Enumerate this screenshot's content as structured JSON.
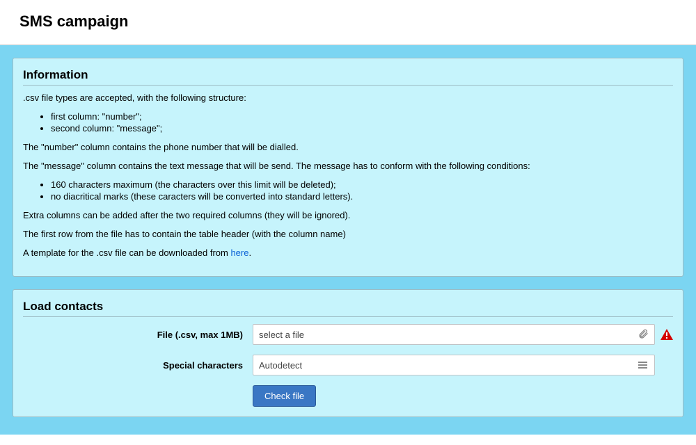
{
  "header": {
    "title": "SMS campaign"
  },
  "info": {
    "heading": "Information",
    "intro": ".csv file types are accepted, with the following structure:",
    "columns": [
      "first column: \"number\";",
      "second column: \"message\";"
    ],
    "number_desc": "The \"number\" column contains the phone number that will be dialled.",
    "message_desc": "The \"message\" column contains the text message that will be send. The message has to conform with the following conditions:",
    "message_rules": [
      "160 characters maximum (the characters over this limit will be deleted);",
      "no diacritical marks (these caracters will be converted into standard letters)."
    ],
    "extra_cols": "Extra columns can be added after the two required columns (they will be ignored).",
    "first_row": "The first row from the file has to contain the table header (with the column name)",
    "template_prefix": "A template for the .csv file can be downloaded from ",
    "template_link": "here",
    "template_suffix": "."
  },
  "load": {
    "heading": "Load contacts",
    "file_label": "File (.csv, max 1MB)",
    "file_value": "select a file",
    "charset_label": "Special characters",
    "charset_value": "Autodetect",
    "check_button": "Check file"
  }
}
